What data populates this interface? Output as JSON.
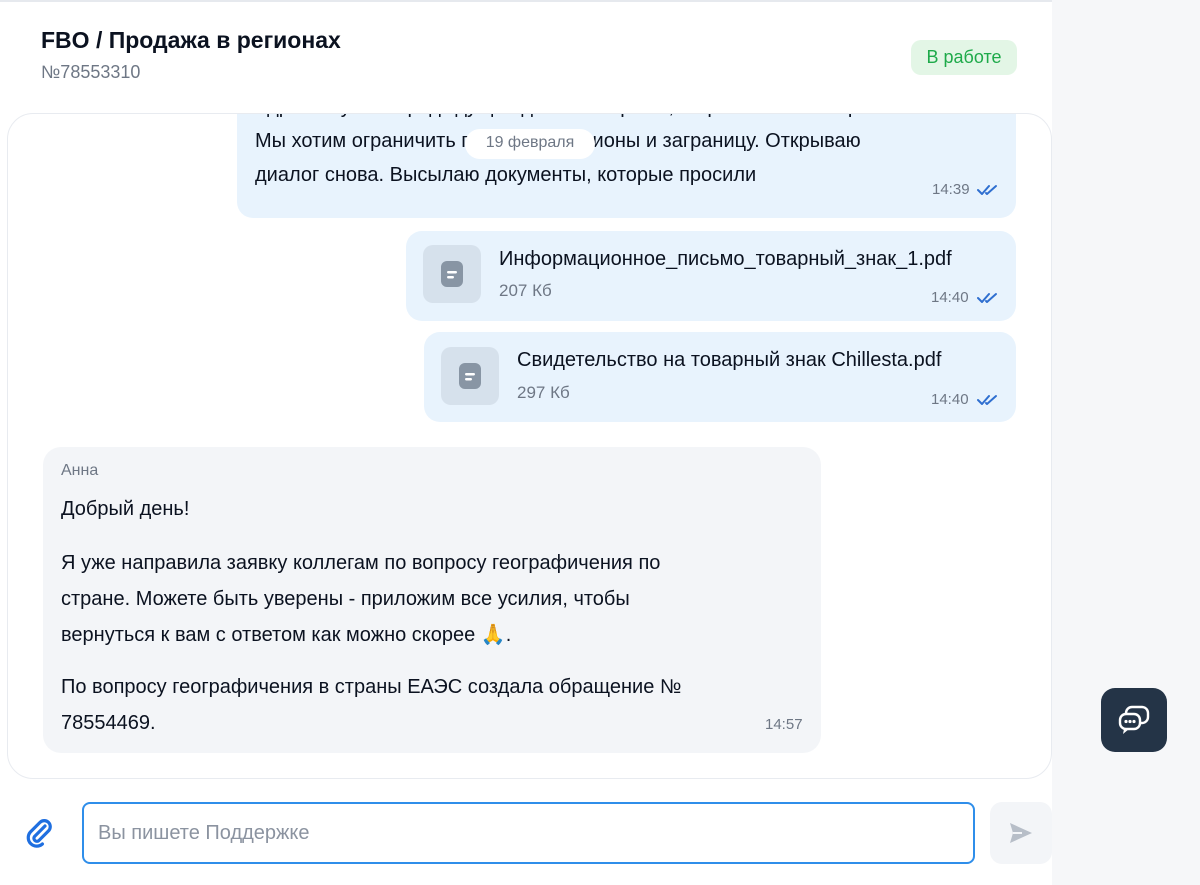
{
  "header": {
    "title": "FBO / Продажа в регионах",
    "ticket_number": "№78553310",
    "status": "В работе"
  },
  "chat": {
    "date_separator": "19 февраля",
    "messages": [
      {
        "lines": [
          "Здравствуйте! Предыдущий диалог закрыли, не решив наш запрос.",
          "Мы хотим ограничить продажи в регионы и заграницу. Открываю",
          "диалог снова. Высылаю документы, которые просили"
        ],
        "time": "14:39"
      }
    ],
    "files": [
      {
        "name": "Информационное_письмо_товарный_знак_1.pdf",
        "size": "207 Кб",
        "time": "14:40"
      },
      {
        "name": "Свидетельство на товарный знак Chillesta.pdf",
        "size": "297 Кб",
        "time": "14:40"
      }
    ],
    "incoming": {
      "sender": "Анна",
      "greeting": "Добрый день!",
      "paragraph1": [
        "Я уже направила заявку коллегам по вопросу географичения по",
        "стране. Можете быть уверены - приложим все усилия, чтобы",
        "вернуться к вам с ответом как можно скорее 🙏."
      ],
      "paragraph2": [
        "По вопросу географичения в страны ЕАЭС создала обращение №",
        "78554469."
      ],
      "time": "14:57"
    }
  },
  "composer": {
    "placeholder": "Вы пишете Поддержке"
  },
  "icons": {
    "attach": "paperclip-icon",
    "send": "send-icon",
    "file": "document-icon",
    "read": "double-check-icon",
    "support": "chat-bubbles-icon"
  },
  "colors": {
    "accent": "#2f8eea",
    "status_bg": "#e3f6e6",
    "status_text": "#1eaa4a",
    "outgoing_bubble": "#e8f3fd",
    "incoming_bubble": "#f3f5f8",
    "fab": "#243447"
  }
}
